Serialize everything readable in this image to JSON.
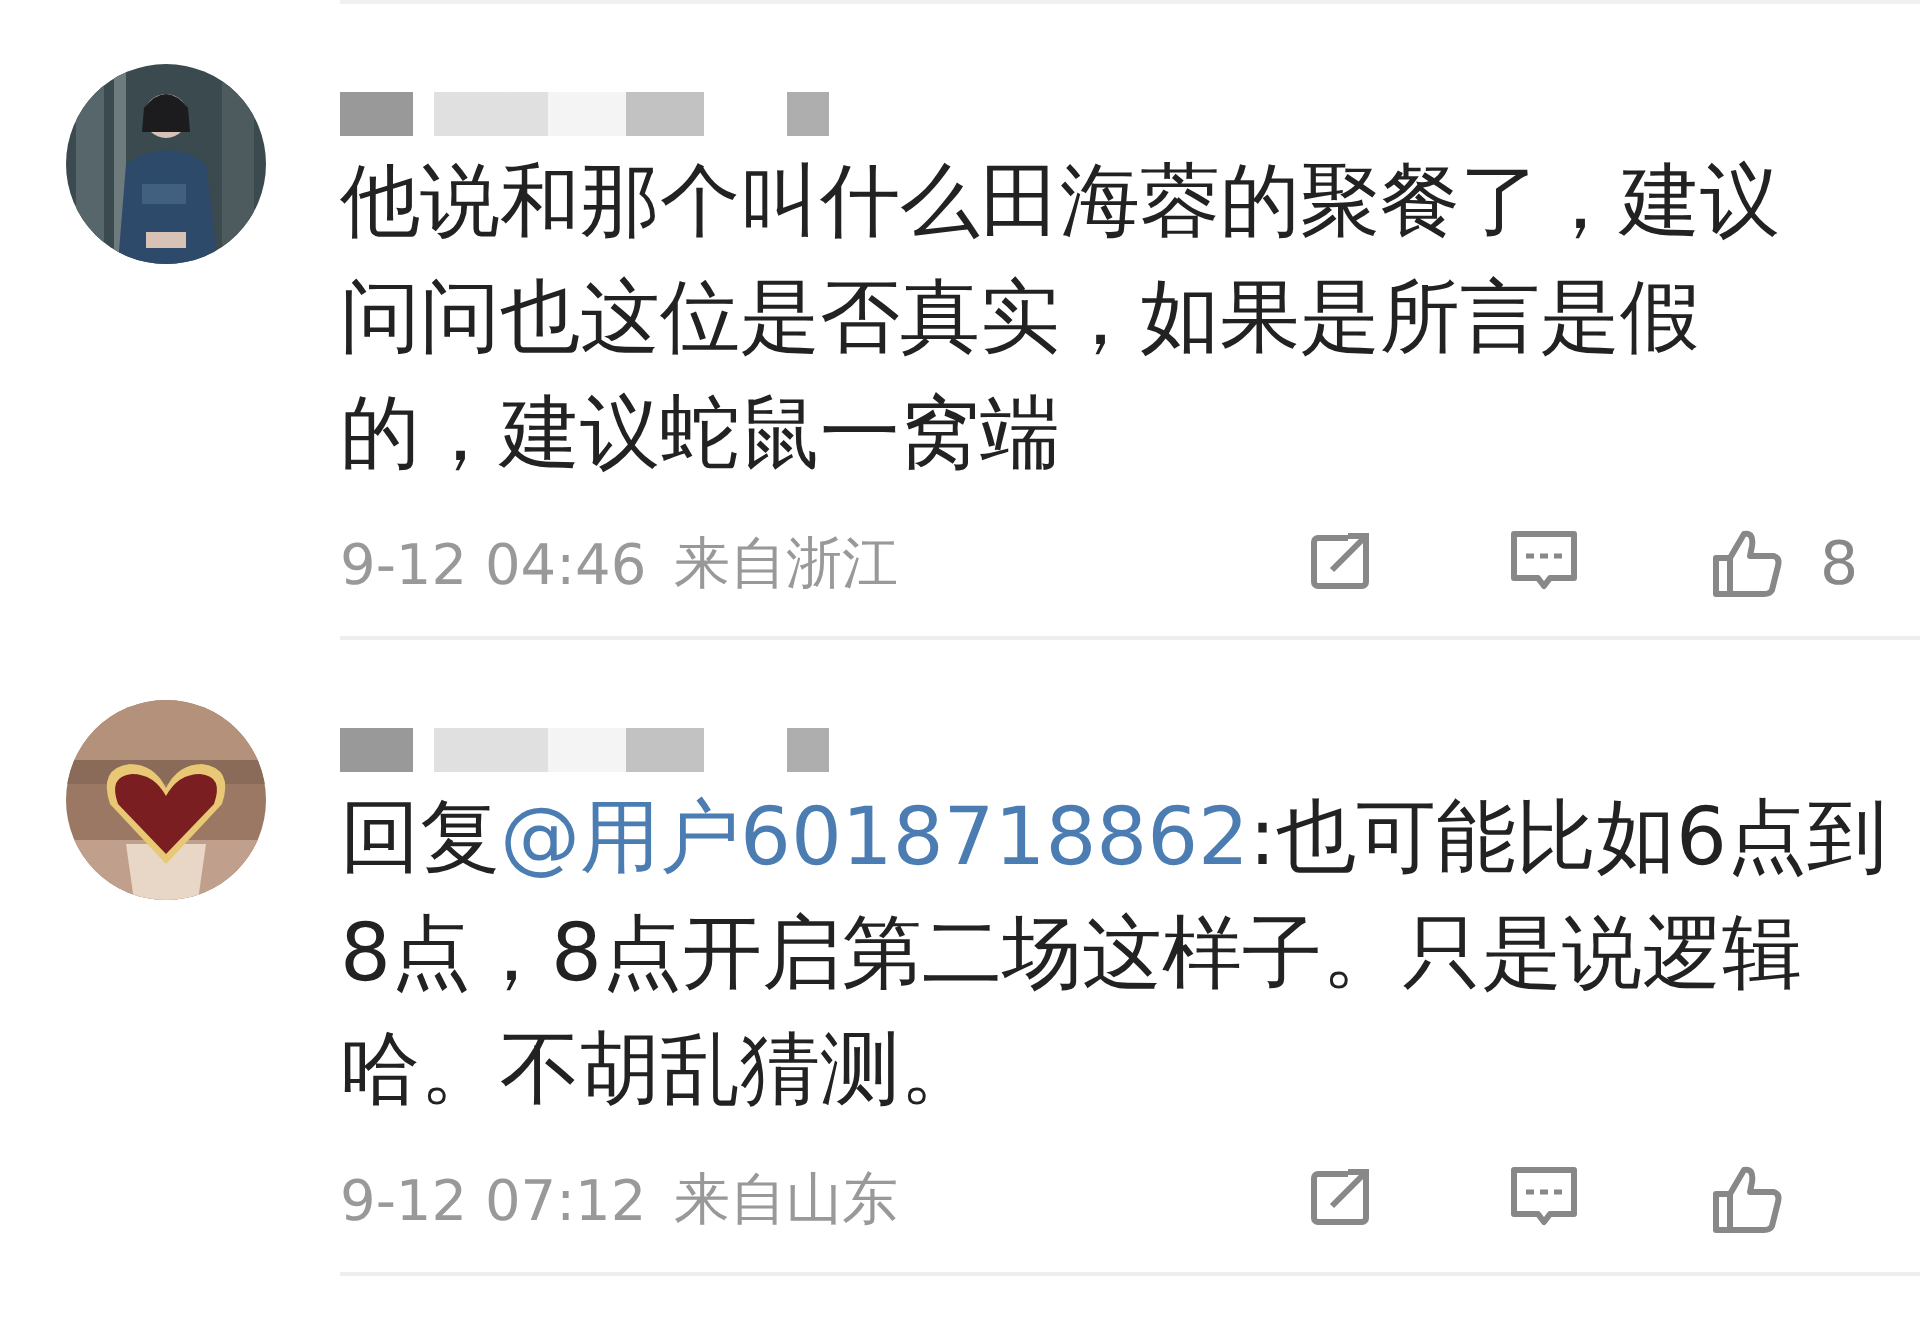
{
  "comments": [
    {
      "avatar": {
        "kind": "picture"
      },
      "lines": [
        [
          {
            "kind": "text",
            "text": "他说和那个叫什么田海蓉的聚餐了，建议"
          }
        ],
        [
          {
            "kind": "text",
            "text": "问问也这位是否真实，如果是所言是假"
          }
        ],
        [
          {
            "kind": "text",
            "text": "的，建议蛇鼠一窝端"
          }
        ]
      ],
      "time": "9-12 04:46",
      "location": "来自浙江",
      "likes": "8"
    },
    {
      "avatar": {
        "kind": "picture"
      },
      "lines": [
        [
          {
            "kind": "text",
            "text": "回复"
          },
          {
            "kind": "mention",
            "text": "@用户6018718862"
          },
          {
            "kind": "text",
            "text": ":也可能比如6点到"
          }
        ],
        [
          {
            "kind": "text",
            "text": "8点，8点开启第二场这样子。只是说逻辑"
          }
        ],
        [
          {
            "kind": "text",
            "text": "哈。不胡乱猜测。"
          }
        ]
      ],
      "time": "9-12 07:12",
      "location": "来自山东"
    }
  ]
}
